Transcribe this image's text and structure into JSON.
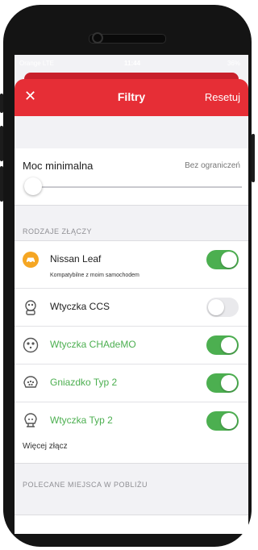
{
  "status_bar": {
    "carrier": "Orange LTE",
    "time": "11:44",
    "battery": "36%"
  },
  "nav": {
    "close_glyph": "✕",
    "title": "Filtry",
    "reset_label": "Resetuj"
  },
  "power": {
    "label": "Moc minimalna",
    "value": "Bez ograniczeń",
    "slider_fraction": 0
  },
  "connectors_section": {
    "header": "RODZAJE ZŁĄCZY",
    "items": [
      {
        "name": "Nissan Leaf",
        "subtitle": "Kompatybilne z moim samochodem",
        "icon": "car-badge-icon",
        "enabled": true
      },
      {
        "name": "Wtyczka CCS",
        "icon": "ccs-plug-icon",
        "enabled": false
      },
      {
        "name": "Wtyczka CHAdeMO",
        "icon": "chademo-plug-icon",
        "enabled": true
      },
      {
        "name": "Gniazdko Typ 2",
        "icon": "type2-socket-icon",
        "enabled": true
      },
      {
        "name": "Wtyczka Typ 2",
        "icon": "type2-plug-icon",
        "enabled": true
      }
    ],
    "more_label": "Więcej złącz"
  },
  "recommended_section": {
    "header": "POLECANE MIEJSCA W POBLIŻU"
  },
  "colors": {
    "brand_red": "#e62e36",
    "toggle_on": "#4caf50",
    "toggle_off": "#e9e9ec",
    "badge_orange": "#f5a623"
  }
}
